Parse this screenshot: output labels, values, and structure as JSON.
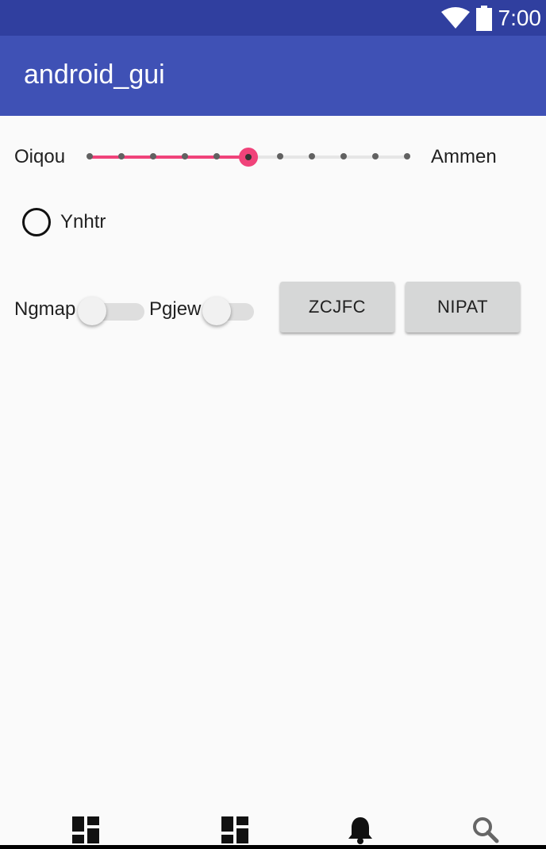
{
  "status_bar": {
    "time": "7:00",
    "wifi_icon": "wifi-icon",
    "battery_icon": "battery-icon"
  },
  "app_bar": {
    "title": "android_gui"
  },
  "seekbar": {
    "left_label": "Oiqou",
    "right_label": "Ammen",
    "steps": 10,
    "value": 5
  },
  "radio": {
    "label": "Ynhtr",
    "checked": false
  },
  "switches": [
    {
      "label": "Ngmap",
      "checked": false
    },
    {
      "label": "Pgjew",
      "checked": false
    }
  ],
  "buttons": [
    {
      "label": "ZCJFC"
    },
    {
      "label": "NIPAT"
    }
  ],
  "bottom_nav": [
    {
      "icon": "dashboard-icon"
    },
    {
      "icon": "dashboard-icon"
    },
    {
      "icon": "notifications-icon"
    },
    {
      "icon": "search-icon"
    }
  ],
  "colors": {
    "primary": "#3f51b5",
    "primary_dark": "#303f9f",
    "accent": "#f0437a"
  }
}
